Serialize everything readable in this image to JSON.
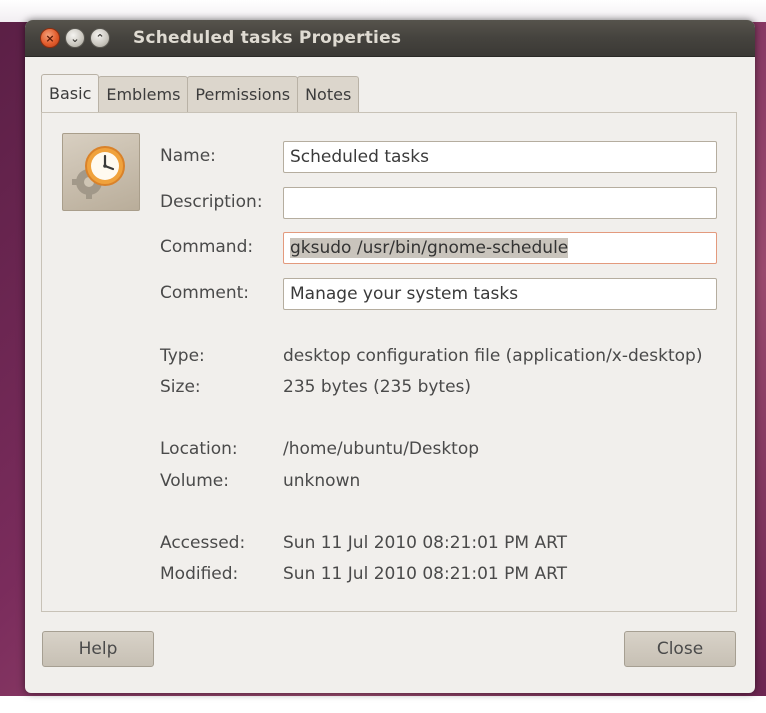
{
  "window": {
    "title": "Scheduled tasks Properties",
    "controls": {
      "close_glyph": "×",
      "minimize_glyph": "⌄",
      "maximize_glyph": "⌃"
    }
  },
  "tabs": [
    {
      "label": "Basic",
      "active": true
    },
    {
      "label": "Emblems",
      "active": false
    },
    {
      "label": "Permissions",
      "active": false
    },
    {
      "label": "Notes",
      "active": false
    }
  ],
  "app_icon": {
    "name": "clock-gear-icon"
  },
  "form": {
    "name": {
      "label": "Name:",
      "value": "Scheduled tasks"
    },
    "description": {
      "label": "Description:",
      "value": ""
    },
    "command": {
      "label": "Command:",
      "value": "gksudo /usr/bin/gnome-schedule"
    },
    "comment": {
      "label": "Comment:",
      "value": "Manage your system tasks"
    }
  },
  "info": {
    "type": {
      "label": "Type:",
      "value": "desktop configuration file (application/x-desktop)"
    },
    "size": {
      "label": "Size:",
      "value": "235 bytes (235 bytes)"
    },
    "location": {
      "label": "Location:",
      "value": "/home/ubuntu/Desktop"
    },
    "volume": {
      "label": "Volume:",
      "value": "unknown"
    },
    "accessed": {
      "label": "Accessed:",
      "value": "Sun 11 Jul 2010 08:21:01 PM ART"
    },
    "modified": {
      "label": "Modified:",
      "value": "Sun 11 Jul 2010 08:21:01 PM ART"
    }
  },
  "buttons": {
    "help": "Help",
    "close": "Close"
  },
  "colors": {
    "titlebar": "#45433e",
    "window_bg": "#f1efec",
    "close_button": "#e25d2d",
    "focus_border": "#e39a7d"
  }
}
